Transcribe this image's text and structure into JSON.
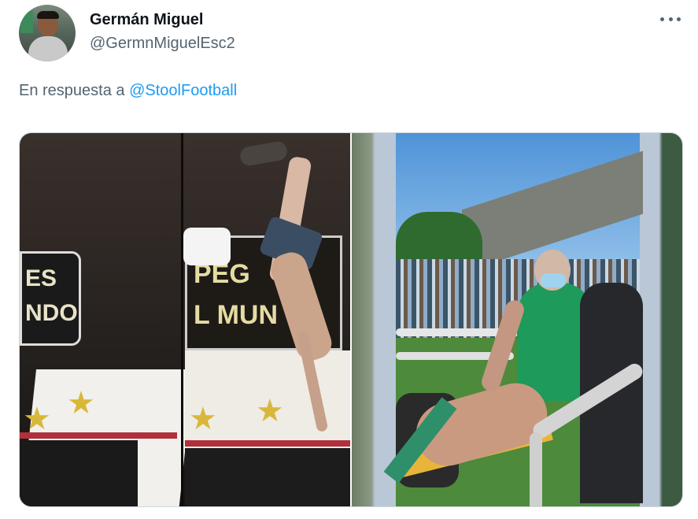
{
  "author": {
    "name": "Germán Miguel",
    "handle": "@GermnMiguelEsc2"
  },
  "reply": {
    "prefix": "En respuesta a",
    "mention": "@StoolFootball"
  },
  "media": {
    "panel1_sign_left": "ES\nNDO",
    "panel1_sign_right": "PEG\nL MUN"
  },
  "icons": {
    "more": "more-horizontal-icon"
  }
}
